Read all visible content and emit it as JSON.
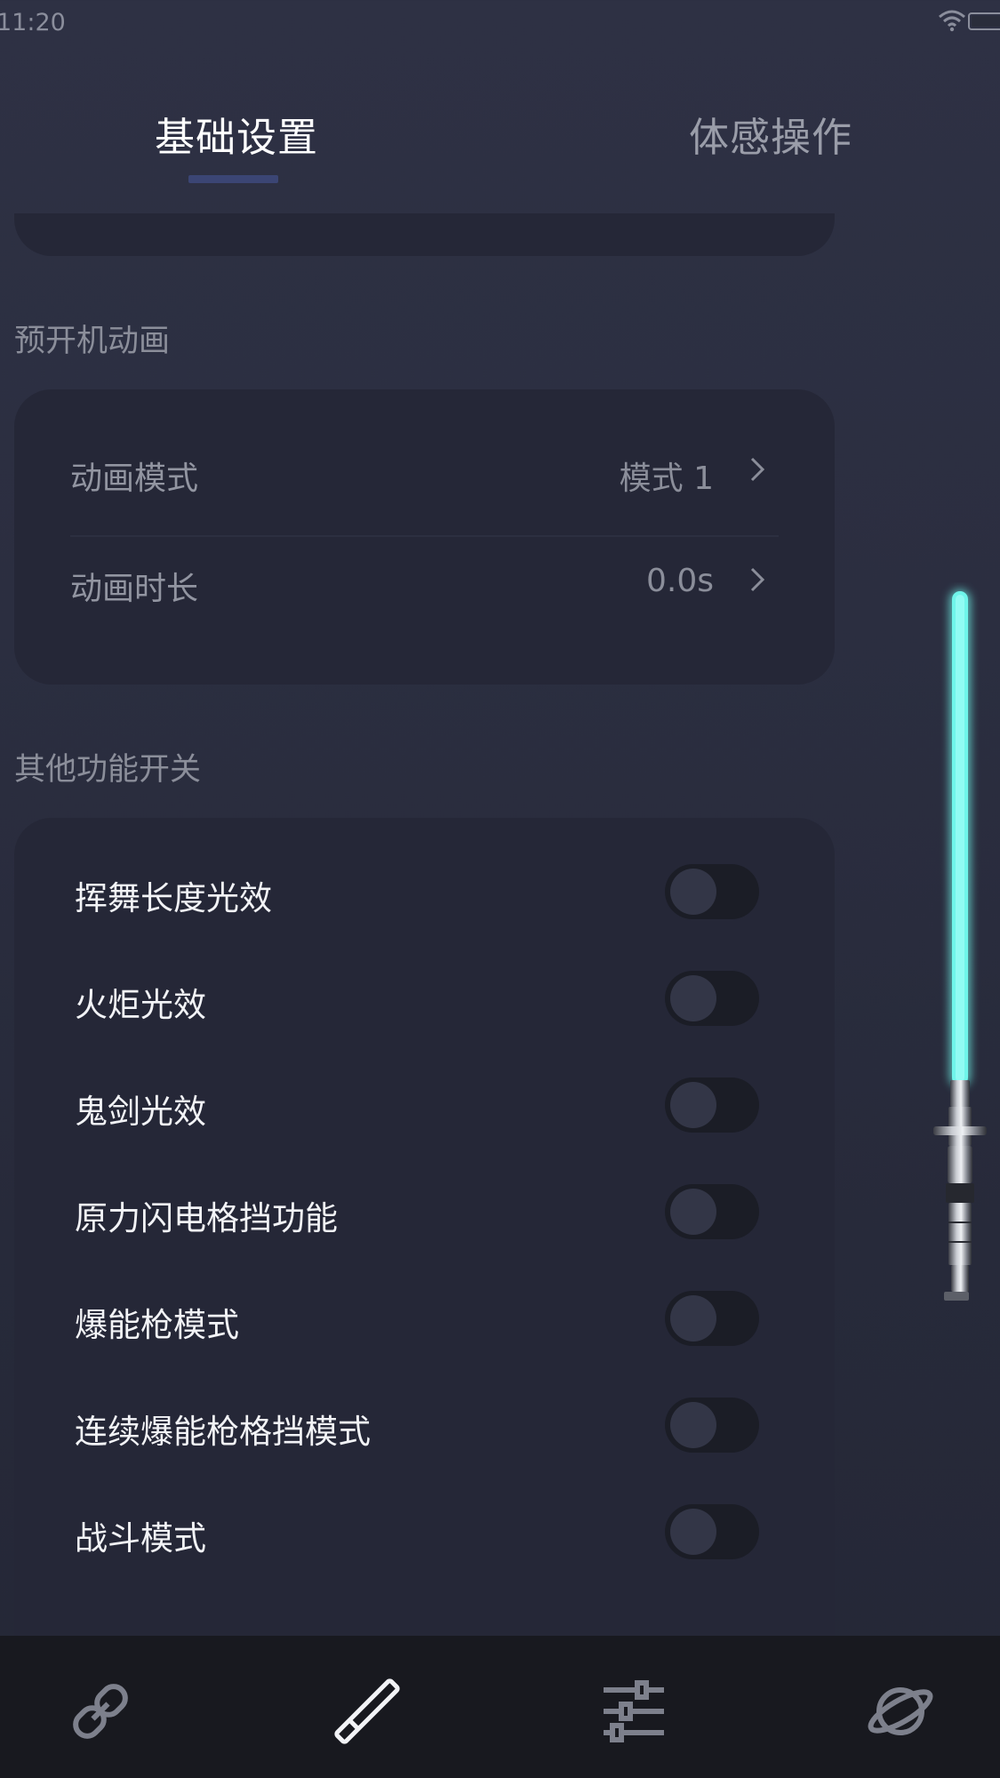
{
  "status_bar": {
    "time": "11:20"
  },
  "tabs": [
    {
      "label": "基础设置",
      "active": true
    },
    {
      "label": "体感操作",
      "active": false
    }
  ],
  "sections": {
    "animation": {
      "title": "预开机动画",
      "rows": [
        {
          "label": "动画模式",
          "value": "模式 1"
        },
        {
          "label": "动画时长",
          "value": "0.0s"
        }
      ]
    },
    "functions": {
      "title": "其他功能开关",
      "toggles": [
        {
          "label": "挥舞长度光效",
          "on": false
        },
        {
          "label": "火炬光效",
          "on": false
        },
        {
          "label": "鬼剑光效",
          "on": false
        },
        {
          "label": "原力闪电格挡功能",
          "on": false
        },
        {
          "label": "爆能枪模式",
          "on": false
        },
        {
          "label": "连续爆能枪格挡模式",
          "on": false
        },
        {
          "label": "战斗模式",
          "on": false
        }
      ]
    }
  },
  "saber": {
    "blade_color": "#6ff5ea"
  },
  "bottom_nav": [
    {
      "icon": "link-icon"
    },
    {
      "icon": "saber-icon"
    },
    {
      "icon": "sliders-icon"
    },
    {
      "icon": "planet-icon"
    }
  ],
  "colors": {
    "background": "#2c2f42",
    "card": "#252737",
    "tab_indicator": "#3b4574",
    "nav_bar": "#18191f"
  }
}
